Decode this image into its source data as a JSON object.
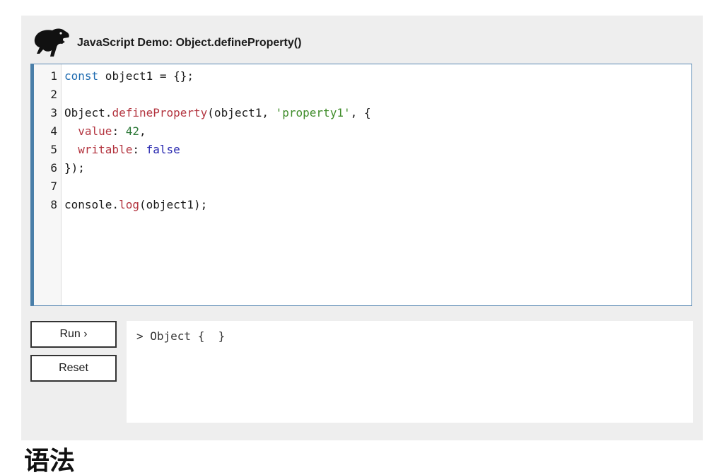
{
  "header": {
    "title": "JavaScript Demo: Object.defineProperty()",
    "logo_icon": "dinosaur-logo-icon"
  },
  "editor": {
    "lines": [
      {
        "n": "1",
        "tokens": [
          {
            "t": "const",
            "c": "kw"
          },
          {
            "t": " object1 = {};",
            "c": ""
          }
        ]
      },
      {
        "n": "2",
        "tokens": []
      },
      {
        "n": "3",
        "tokens": [
          {
            "t": "Object.",
            "c": ""
          },
          {
            "t": "defineProperty",
            "c": "fn"
          },
          {
            "t": "(object1, ",
            "c": ""
          },
          {
            "t": "'property1'",
            "c": "str"
          },
          {
            "t": ", {",
            "c": ""
          }
        ]
      },
      {
        "n": "4",
        "tokens": [
          {
            "t": "  ",
            "c": ""
          },
          {
            "t": "value",
            "c": "prop"
          },
          {
            "t": ": ",
            "c": ""
          },
          {
            "t": "42",
            "c": "num"
          },
          {
            "t": ",",
            "c": ""
          }
        ]
      },
      {
        "n": "5",
        "tokens": [
          {
            "t": "  ",
            "c": ""
          },
          {
            "t": "writable",
            "c": "prop"
          },
          {
            "t": ": ",
            "c": ""
          },
          {
            "t": "false",
            "c": "bool"
          }
        ]
      },
      {
        "n": "6",
        "tokens": [
          {
            "t": "});",
            "c": ""
          }
        ]
      },
      {
        "n": "7",
        "tokens": []
      },
      {
        "n": "8",
        "tokens": [
          {
            "t": "console.",
            "c": ""
          },
          {
            "t": "log",
            "c": "fn"
          },
          {
            "t": "(object1);",
            "c": ""
          }
        ]
      }
    ]
  },
  "controls": {
    "run_label": "Run ›",
    "reset_label": "Reset"
  },
  "output": {
    "text": "> Object {  }"
  },
  "next_heading": "语法",
  "colors": {
    "panel": "#eeeeee",
    "editor_border": "#4a7fa9",
    "keyword": "#1f6bb0",
    "function": "#b3343f",
    "string": "#3f8c2a",
    "number": "#2f7a3a",
    "boolean": "#2a2ab0"
  }
}
